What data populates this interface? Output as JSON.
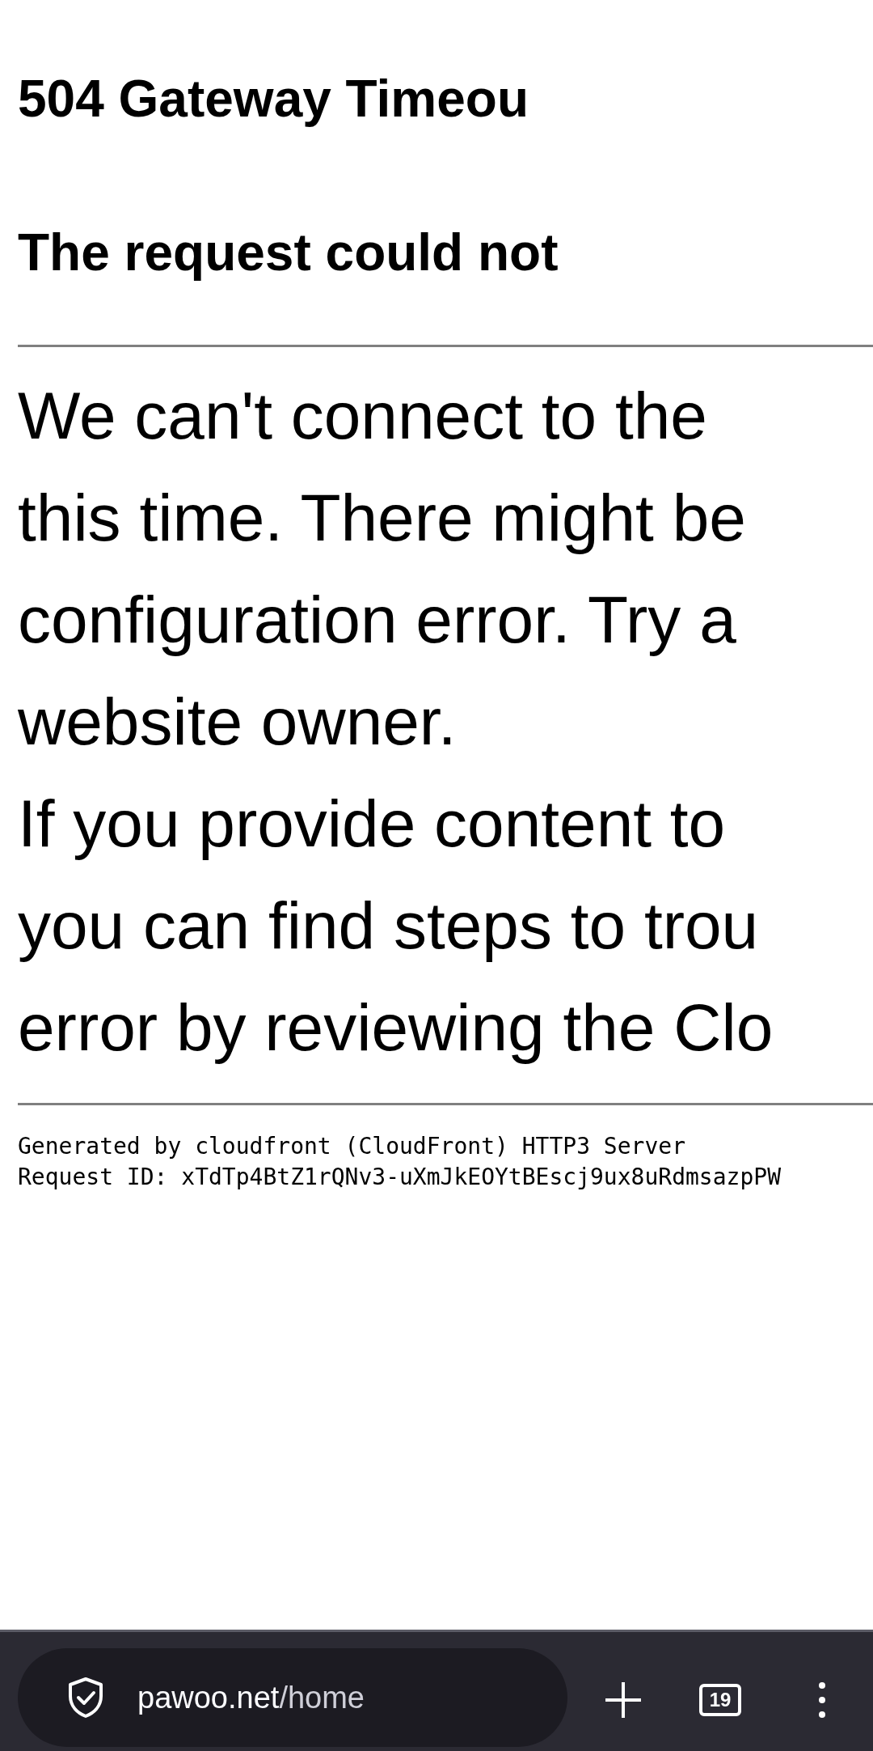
{
  "page": {
    "title": "504 Gateway Timeou",
    "subtitle": "The request could not",
    "paragraphs": [
      {
        "lines": [
          "We can't connect to the",
          "this time. There might be",
          "configuration error. Try a",
          "website owner."
        ]
      },
      {
        "lines": [
          "If you provide content to",
          "you can find steps to trou",
          "error by reviewing the Clo"
        ]
      }
    ],
    "footer": [
      "Generated by cloudfront (CloudFront) HTTP3 Server",
      "Request ID: xTdTp4BtZ1rQNv3-uXmJkEOYtBEscj9ux8uRdmsazpPW"
    ]
  },
  "toolbar": {
    "url_host": "pawoo.net",
    "url_path": "/home",
    "tab_count": "19"
  }
}
